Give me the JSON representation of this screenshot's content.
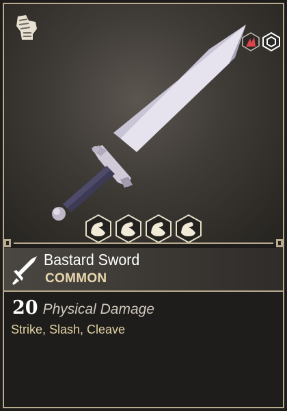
{
  "item": {
    "name": "Bastard Sword",
    "rarity": "COMMON",
    "damage_value": "20",
    "damage_type": "Physical Damage",
    "attack_types": "Strike, Slash, Cleave"
  },
  "icons": {
    "category": "gauntlet-icon",
    "attributes": [
      "strength-icon",
      "strength-icon",
      "strength-icon",
      "strength-icon"
    ],
    "header": "sword-icon",
    "tags": [
      "fire-damage-icon",
      "hexagon-slot-icon"
    ]
  },
  "colors": {
    "frame": "#b9ab8f",
    "rarity": "#e9d8ae",
    "attack_types": "#e3d1a4"
  }
}
